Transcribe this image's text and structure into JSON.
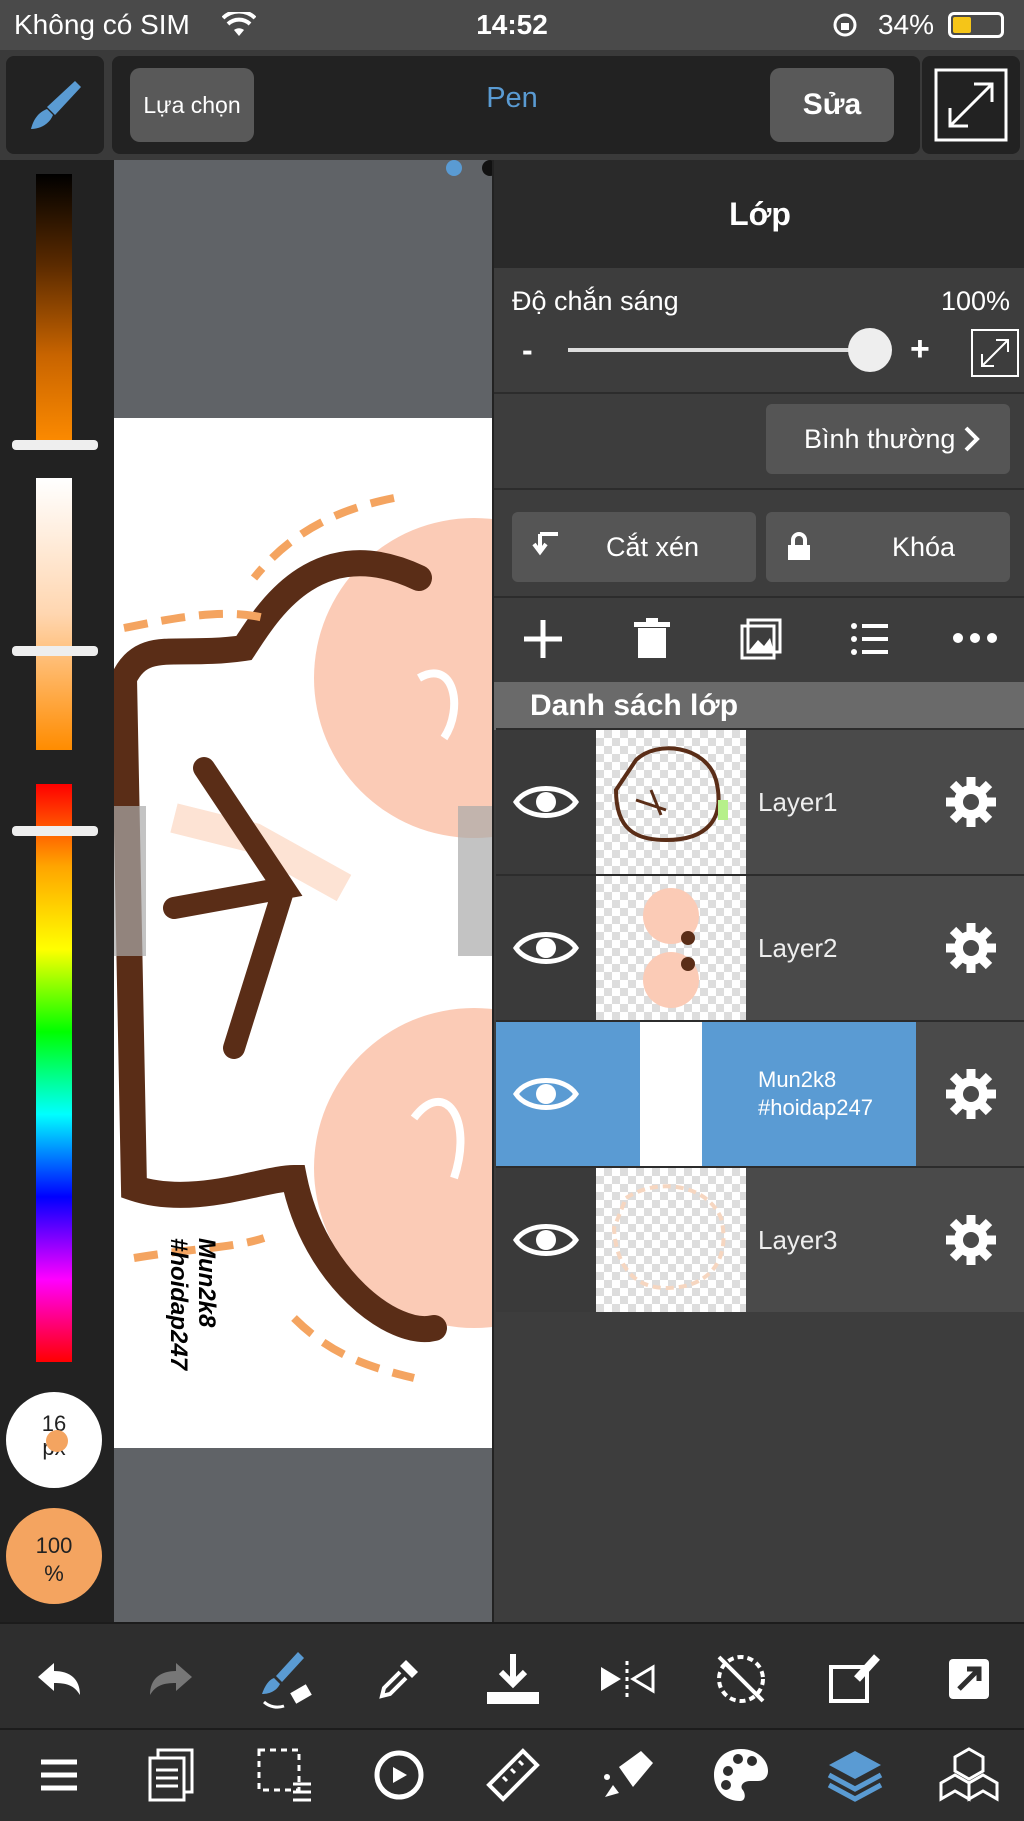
{
  "status": {
    "carrier": "Không có SIM",
    "time": "14:52",
    "battery": "34%"
  },
  "toolbar": {
    "select_label": "Lựa chọn",
    "tool_name": "Pen",
    "edit_label": "Sửa"
  },
  "brush": {
    "size_value": "16",
    "size_unit": "px",
    "opacity_value": "100",
    "opacity_unit": "%"
  },
  "canvas": {
    "watermark_line1": "Mun2k8",
    "watermark_line2": "#hoidap247"
  },
  "layer_panel": {
    "title": "Lớp",
    "opacity_label": "Độ chắn sáng",
    "opacity_value": "100%",
    "opacity_level": 1.0,
    "minus": "-",
    "plus": "+",
    "blend_mode": "Bình thường",
    "clip_label": "Cắt xén",
    "lock_label": "Khóa",
    "list_header": "Danh sách lớp",
    "layers": [
      {
        "name": "Layer1",
        "selected": false
      },
      {
        "name": "Layer2",
        "selected": false
      },
      {
        "name_line1": "Mun2k8",
        "name_line2": "#hoidap247",
        "selected": true
      },
      {
        "name": "Layer3",
        "selected": false
      }
    ]
  },
  "colors": {
    "accent": "#5a9bd3",
    "brush_color": "#f4a460",
    "panel": "#3d3d3d"
  },
  "bottom_icons": [
    "undo-icon",
    "redo-icon",
    "brush-swap-icon",
    "eyedropper-icon",
    "save-icon",
    "flip-icon",
    "no-rotate-icon",
    "transform-icon",
    "share-icon",
    "menu-icon",
    "pages-icon",
    "selection-icon",
    "rotate-canvas-icon",
    "ruler-icon",
    "fill-icon",
    "palette-icon",
    "layers-icon",
    "materials-icon"
  ]
}
